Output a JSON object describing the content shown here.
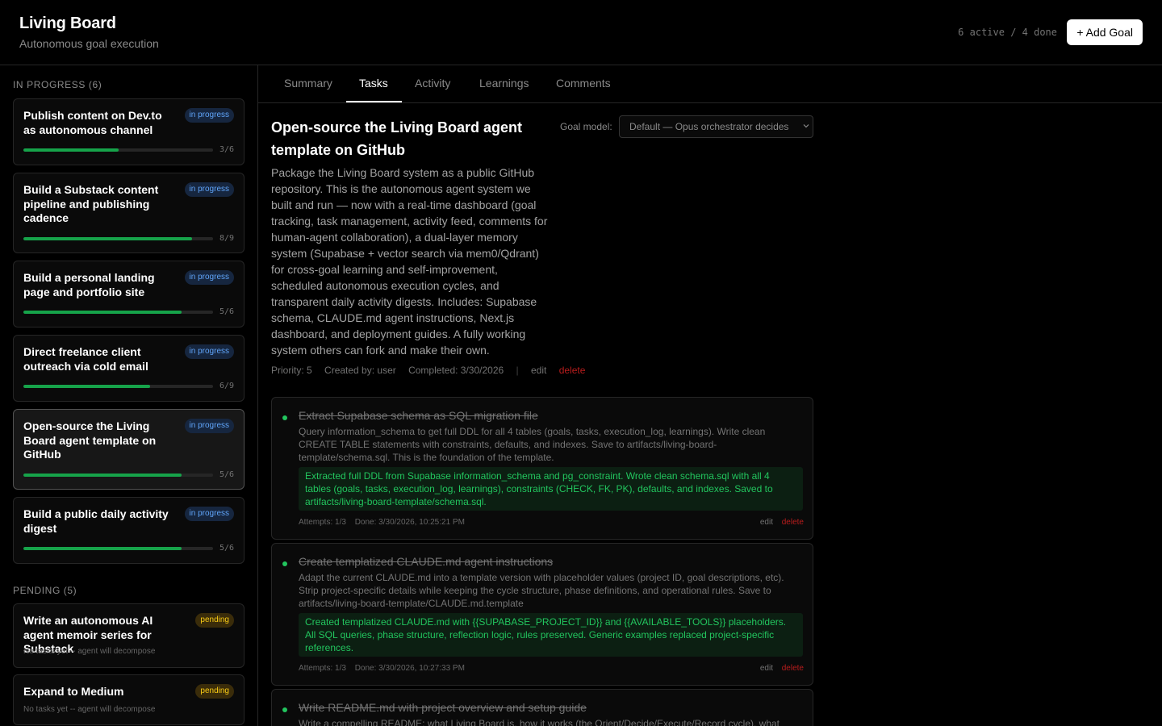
{
  "header": {
    "title": "Living Board",
    "subtitle": "Autonomous goal execution",
    "counts": "6 active / 4 done",
    "add_goal": "+ Add Goal"
  },
  "sidebar": {
    "in_progress_label": "IN PROGRESS (6)",
    "pending_label": "PENDING (5)",
    "in_progress": [
      {
        "title": "Publish content on Dev.to as autonomous channel",
        "badge": "in progress",
        "count": "3/6",
        "progress": 0.5
      },
      {
        "title": "Build a Substack content pipeline and publishing cadence",
        "badge": "in progress",
        "count": "8/9",
        "progress": 0.889
      },
      {
        "title": "Build a personal landing page and portfolio site",
        "badge": "in progress",
        "count": "5/6",
        "progress": 0.833
      },
      {
        "title": "Direct freelance client outreach via cold email",
        "badge": "in progress",
        "count": "6/9",
        "progress": 0.667
      },
      {
        "title": "Open-source the Living Board agent template on GitHub",
        "badge": "in progress",
        "count": "5/6",
        "progress": 0.833
      },
      {
        "title": "Build a public daily activity digest",
        "badge": "in progress",
        "count": "5/6",
        "progress": 0.833
      }
    ],
    "pending": [
      {
        "title": "Write an autonomous AI agent memoir series for Substack",
        "badge": "pending",
        "note": "No tasks yet -- agent will decompose"
      },
      {
        "title": "Expand to Medium",
        "badge": "pending",
        "note": "No tasks yet -- agent will decompose"
      }
    ]
  },
  "tabs": [
    "Summary",
    "Tasks",
    "Activity",
    "Learnings",
    "Comments"
  ],
  "goal": {
    "title": "Open-source the Living Board agent template on GitHub",
    "model_label": "Goal model:",
    "model_value": "Default — Opus orchestrator decides",
    "description": "Package the Living Board system as a public GitHub repository. This is the autonomous agent system we built and run — now with a real-time dashboard (goal tracking, task management, activity feed, comments for human-agent collaboration), a dual-layer memory system (Supabase + vector search via mem0/Qdrant) for cross-goal learning and self-improvement, scheduled autonomous execution cycles, and transparent daily activity digests. Includes: Supabase schema, CLAUDE.md agent instructions, Next.js dashboard, and deployment guides. A fully working system others can fork and make their own.",
    "priority": "Priority: 5",
    "created_by": "Created by: user",
    "completed": "Completed: 3/30/2026",
    "sep": "|",
    "edit": "edit",
    "delete": "delete"
  },
  "tasks": [
    {
      "title": "Extract Supabase schema as SQL migration file",
      "description": "Query information_schema to get full DDL for all 4 tables (goals, tasks, execution_log, learnings). Write clean CREATE TABLE statements with constraints, defaults, and indexes. Save to artifacts/living-board-template/schema.sql. This is the foundation of the template.",
      "result": "Extracted full DDL from Supabase information_schema and pg_constraint. Wrote clean schema.sql with all 4 tables (goals, tasks, execution_log, learnings), constraints (CHECK, FK, PK), defaults, and indexes. Saved to artifacts/living-board-template/schema.sql.",
      "attempts": "Attempts: 1/3",
      "done": "Done: 3/30/2026, 10:25:21 PM",
      "edit": "edit",
      "delete": "delete"
    },
    {
      "title": "Create templatized CLAUDE.md agent instructions",
      "description": "Adapt the current CLAUDE.md into a template version with placeholder values (project ID, goal descriptions, etc). Strip project-specific details while keeping the cycle structure, phase definitions, and operational rules. Save to artifacts/living-board-template/CLAUDE.md.template",
      "result": "Created templatized CLAUDE.md with {{SUPABASE_PROJECT_ID}} and {{AVAILABLE_TOOLS}} placeholders. All SQL queries, phase structure, reflection logic, rules preserved. Generic examples replaced project-specific references.",
      "attempts": "Attempts: 1/3",
      "done": "Done: 3/30/2026, 10:27:33 PM",
      "edit": "edit",
      "delete": "delete"
    },
    {
      "title": "Write README.md with project overview and setup guide",
      "description": "Write a compelling README: what Living Board is, how it works (the Orient/Decide/Execute/Record cycle), what"
    }
  ]
}
